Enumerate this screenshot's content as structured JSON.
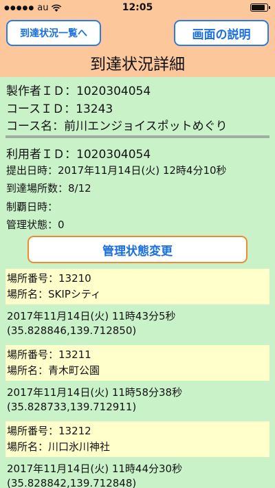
{
  "status_bar": {
    "signal": "●●●●●",
    "carrier": "au",
    "time": "12:05",
    "battery_level": 0.9
  },
  "header": {
    "back_button": "到達状況一覧へ",
    "explain_button": "画面の説明",
    "title": "到達状況詳細"
  },
  "course": {
    "maker_id": "製作者ＩＤ：1020304054",
    "course_id": "コースＩＤ：13243",
    "course_name": "コース名：前川エンジョイスポットめぐり"
  },
  "user": {
    "user_id": "利用者ＩＤ：1020304054",
    "submitted": "提出日時：2017年11月14日(火) 12時4分10秒",
    "reached_count": "到達場所数：8/12",
    "conquered": "制覇日時：",
    "manage_state": "管理状態：0",
    "change_button": "管理状態変更"
  },
  "places": [
    {
      "number": "場所番号：13210",
      "name": "場所名：SKIPシティ",
      "datetime": "2017年11月14日(火) 11時43分5秒",
      "coords": "(35.828846,139.712850)"
    },
    {
      "number": "場所番号：13211",
      "name": "場所名：青木町公園",
      "datetime": "2017年11月14日(火) 11時58分38秒",
      "coords": "(35.828733,139.712911)"
    },
    {
      "number": "場所番号：13212",
      "name": "場所名：川口氷川神社",
      "datetime": "2017年11月14日(火) 11時44分30秒",
      "coords": "(35.828842,139.712848)"
    }
  ]
}
